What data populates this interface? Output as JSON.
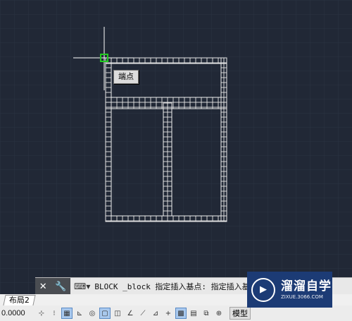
{
  "tooltip": {
    "text": "端点"
  },
  "command_line": {
    "close_icon": "close-icon",
    "settings_icon": "wrench-icon",
    "prompt_icon": "command-prompt-icon",
    "text": "BLOCK _block 指定插入基点: 指定插入基"
  },
  "tabs": {
    "layout2": "布局2"
  },
  "status_bar": {
    "coords": "0.0000",
    "model_label": "模型"
  },
  "watermark": {
    "name": "溜溜自学",
    "url": "ZIXUE.3066.COM"
  },
  "colors": {
    "background": "#212836",
    "grid": "#2c3444",
    "drawing": "#e8e8e8",
    "snap_marker": "#22cc22"
  }
}
